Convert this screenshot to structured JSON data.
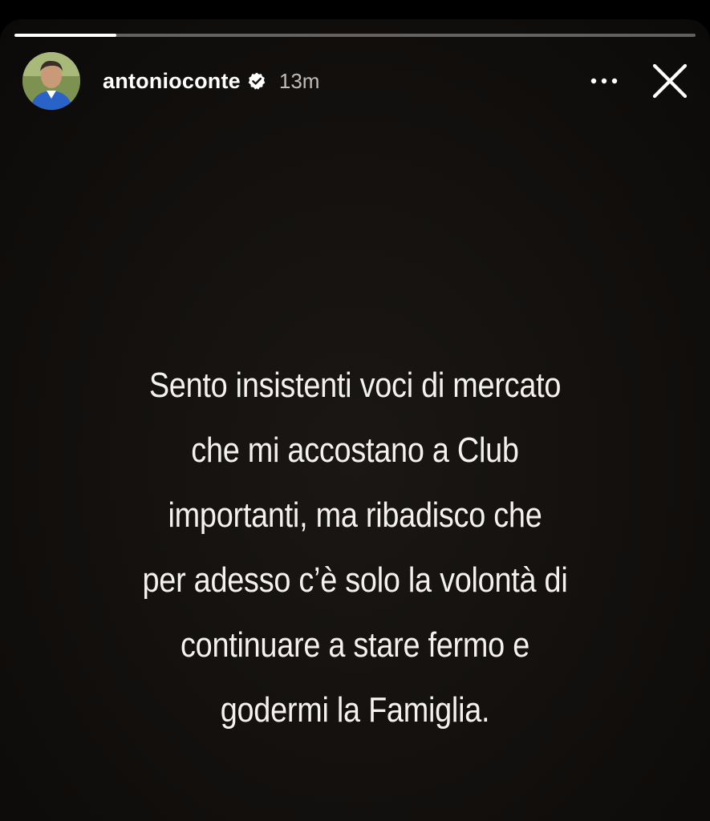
{
  "story": {
    "progress_fraction": 0.15,
    "header": {
      "username": "antonioconte",
      "verified": true,
      "timestamp": "13m",
      "more_icon": "more-horizontal-icon",
      "close_icon": "close-icon"
    },
    "text_lines": [
      "Sento insistenti voci di mercato",
      "che mi accostano a Club",
      "importanti, ma ribadisco che",
      "per adesso c’è solo la volontà di",
      "continuare a stare fermo e",
      "godermi la Famiglia."
    ]
  },
  "colors": {
    "background": "#0f0d0b",
    "text": "#f4f2ee",
    "progress_track": "rgba(255,255,255,0.35)",
    "progress_fill": "#ffffff"
  }
}
